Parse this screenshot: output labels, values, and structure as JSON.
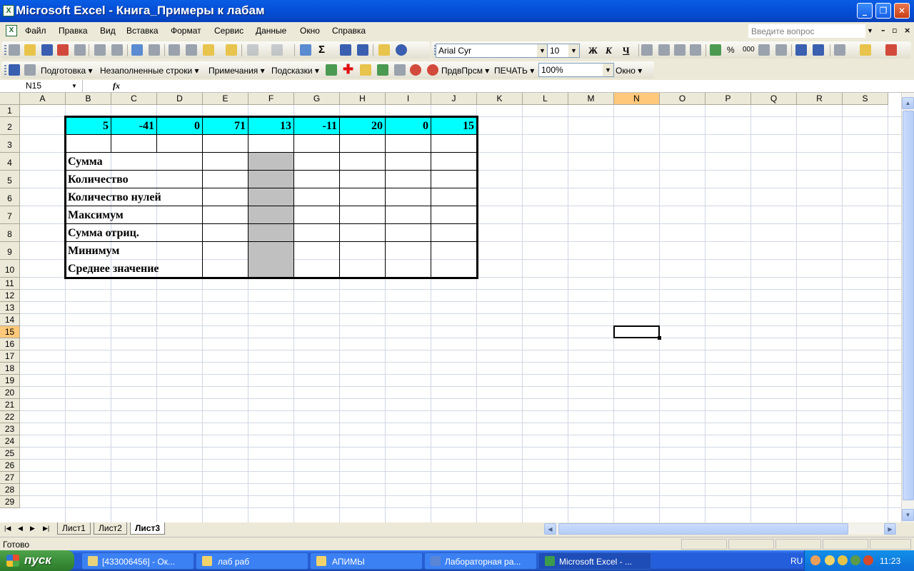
{
  "window": {
    "title": "Microsoft Excel - Книга_Примеры к лабам"
  },
  "menu": {
    "items": [
      "Файл",
      "Правка",
      "Вид",
      "Вставка",
      "Формат",
      "Сервис",
      "Данные",
      "Окно",
      "Справка"
    ],
    "help_placeholder": "Введите вопрос"
  },
  "format_toolbar": {
    "font": "Arial Cyr",
    "size": "10",
    "bold": "Ж",
    "italic": "К",
    "underline": "Ч",
    "percent": "%",
    "thousands": "000"
  },
  "custom_toolbar": {
    "items": [
      "Подготовка",
      "Незаполненные строки",
      "Примечания",
      "Подсказки",
      "ПрдвПрсм",
      "ПЕЧАТЬ",
      "Окно"
    ],
    "zoom": "100%"
  },
  "formula_bar": {
    "name_box": "N15",
    "fx": "fx",
    "formula": ""
  },
  "grid": {
    "columns": [
      "A",
      "B",
      "C",
      "D",
      "E",
      "F",
      "G",
      "H",
      "I",
      "J",
      "K",
      "L",
      "M",
      "N",
      "O",
      "P",
      "Q",
      "R",
      "S"
    ],
    "selected_column": "N",
    "rows": [
      "1",
      "2",
      "3",
      "4",
      "5",
      "6",
      "7",
      "8",
      "9",
      "10",
      "11",
      "12",
      "13",
      "14",
      "15",
      "16",
      "17",
      "18",
      "19",
      "20",
      "21",
      "22",
      "23",
      "24",
      "25",
      "26",
      "27",
      "28",
      "29"
    ],
    "selected_row": "15",
    "row2_values": [
      "5",
      "-41",
      "0",
      "71",
      "13",
      "-11",
      "20",
      "0",
      "15"
    ],
    "labels": [
      "Сумма",
      "Количество",
      "Количество нулей",
      "Максимум",
      "Сумма отриц.",
      "Минимум",
      "Среднее значение"
    ],
    "highlight_color": "#00ffff",
    "shaded_color": "#c0c0c0"
  },
  "sheets": {
    "tabs": [
      "Лист1",
      "Лист2",
      "Лист3"
    ],
    "active": "Лист3"
  },
  "status": {
    "text": "Готово"
  },
  "taskbar": {
    "start": "пуск",
    "tasks": [
      "[433006456] - Ок...",
      "лаб раб",
      "АПИМЫ",
      "Лабораторная ра...",
      "Microsoft Excel - ..."
    ],
    "active_task": "Microsoft Excel - ...",
    "lang": "RU",
    "clock": "11:23"
  }
}
